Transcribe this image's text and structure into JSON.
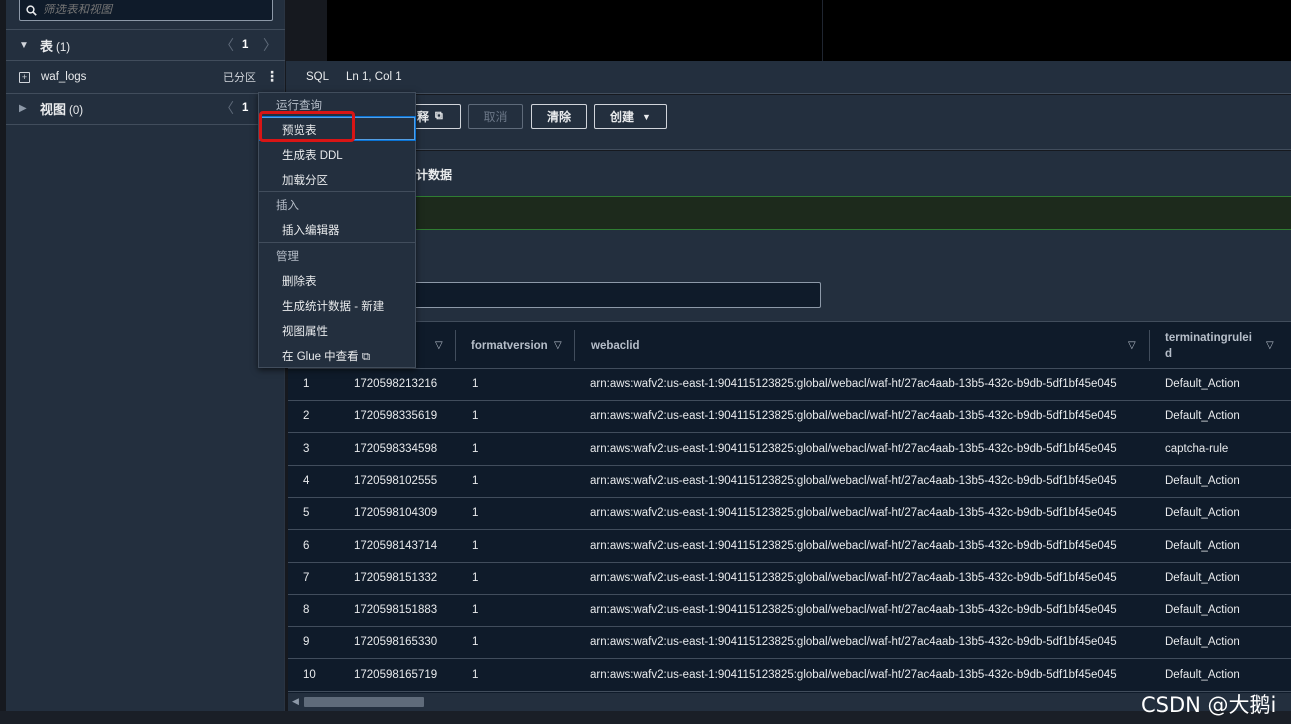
{
  "left_panel": {
    "filter_placeholder": "筛选表和视图",
    "tables": {
      "title": "表",
      "count": "(1)",
      "page": "1"
    },
    "table_item": {
      "name": "waf_logs",
      "badge": "已分区"
    },
    "views": {
      "title": "视图",
      "count": "(0)",
      "page": "1"
    }
  },
  "statusbar": {
    "language": "SQL",
    "cursor_position": "Ln 1, Col 1"
  },
  "actions": {
    "explain_partial": "释",
    "cancel": "取消",
    "clear": "清除",
    "create": "创建"
  },
  "results": {
    "stats_tab_partial": "计数据"
  },
  "context_menu": {
    "group_run": "运行查询",
    "preview_table": "预览表",
    "generate_ddl": "生成表 DDL",
    "load_partitions": "加载分区",
    "group_insert": "插入",
    "insert_editor": "插入编辑器",
    "group_manage": "管理",
    "delete_table": "删除表",
    "generate_stats": "生成统计数据 - 新建",
    "view_properties": "视图属性",
    "view_in_glue": "在 Glue 中查看"
  },
  "grid": {
    "columns": [
      "formatversion",
      "webaclid",
      "terminatingrulei\nd"
    ],
    "rows": [
      {
        "n": "1",
        "timestamp": "1720598213216",
        "formatversion": "1",
        "webaclid": "arn:aws:wafv2:us-east-1:904115123825:global/webacl/waf-ht/27ac4aab-13b5-432c-b9db-5df1bf45e045",
        "terminatingruleid": "Default_Action"
      },
      {
        "n": "2",
        "timestamp": "1720598335619",
        "formatversion": "1",
        "webaclid": "arn:aws:wafv2:us-east-1:904115123825:global/webacl/waf-ht/27ac4aab-13b5-432c-b9db-5df1bf45e045",
        "terminatingruleid": "Default_Action"
      },
      {
        "n": "3",
        "timestamp": "1720598334598",
        "formatversion": "1",
        "webaclid": "arn:aws:wafv2:us-east-1:904115123825:global/webacl/waf-ht/27ac4aab-13b5-432c-b9db-5df1bf45e045",
        "terminatingruleid": "captcha-rule"
      },
      {
        "n": "4",
        "timestamp": "1720598102555",
        "formatversion": "1",
        "webaclid": "arn:aws:wafv2:us-east-1:904115123825:global/webacl/waf-ht/27ac4aab-13b5-432c-b9db-5df1bf45e045",
        "terminatingruleid": "Default_Action"
      },
      {
        "n": "5",
        "timestamp": "1720598104309",
        "formatversion": "1",
        "webaclid": "arn:aws:wafv2:us-east-1:904115123825:global/webacl/waf-ht/27ac4aab-13b5-432c-b9db-5df1bf45e045",
        "terminatingruleid": "Default_Action"
      },
      {
        "n": "6",
        "timestamp": "1720598143714",
        "formatversion": "1",
        "webaclid": "arn:aws:wafv2:us-east-1:904115123825:global/webacl/waf-ht/27ac4aab-13b5-432c-b9db-5df1bf45e045",
        "terminatingruleid": "Default_Action"
      },
      {
        "n": "7",
        "timestamp": "1720598151332",
        "formatversion": "1",
        "webaclid": "arn:aws:wafv2:us-east-1:904115123825:global/webacl/waf-ht/27ac4aab-13b5-432c-b9db-5df1bf45e045",
        "terminatingruleid": "Default_Action"
      },
      {
        "n": "8",
        "timestamp": "1720598151883",
        "formatversion": "1",
        "webaclid": "arn:aws:wafv2:us-east-1:904115123825:global/webacl/waf-ht/27ac4aab-13b5-432c-b9db-5df1bf45e045",
        "terminatingruleid": "Default_Action"
      },
      {
        "n": "9",
        "timestamp": "1720598165330",
        "formatversion": "1",
        "webaclid": "arn:aws:wafv2:us-east-1:904115123825:global/webacl/waf-ht/27ac4aab-13b5-432c-b9db-5df1bf45e045",
        "terminatingruleid": "Default_Action"
      },
      {
        "n": "10",
        "timestamp": "1720598165719",
        "formatversion": "1",
        "webaclid": "arn:aws:wafv2:us-east-1:904115123825:global/webacl/waf-ht/27ac4aab-13b5-432c-b9db-5df1bf45e045",
        "terminatingruleid": "Default_Action"
      }
    ]
  },
  "watermark": "CSDN @大鹅i",
  "colors": {
    "panel": "#232f3e",
    "background": "#16191f",
    "accent": "#0972d3",
    "highlight_box": "#d91515",
    "success": "#2f7d32"
  },
  "icons": {
    "search": "search-icon",
    "caret_down": "caret-down-icon",
    "caret_right": "caret-right-icon",
    "expand": "expand-box-icon",
    "kebab": "kebab-icon",
    "external": "external-link-icon",
    "filter": "filter-icon"
  }
}
